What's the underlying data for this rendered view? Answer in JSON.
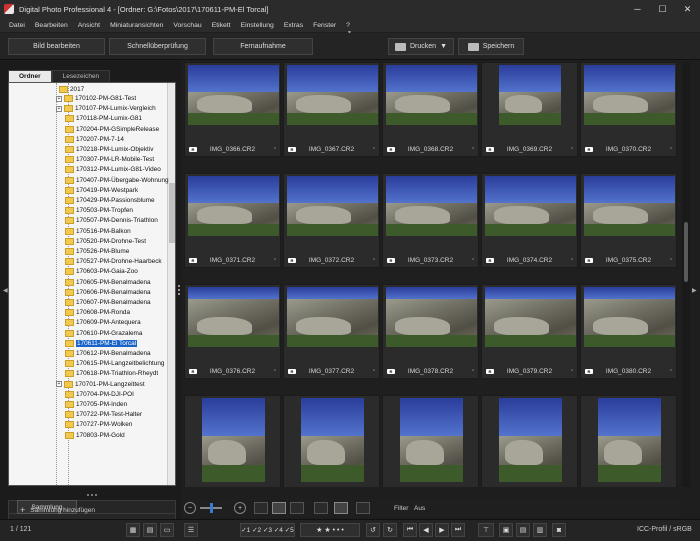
{
  "window": {
    "title": "Digital Photo Professional 4 - [Ordner: G:\\Fotos\\2017\\170611-PM-El Torcal]",
    "controls": [
      "─",
      "☐",
      "✕"
    ]
  },
  "menu": [
    "Datei",
    "Bearbeiten",
    "Ansicht",
    "Miniaturansichten",
    "Vorschau",
    "Etikett",
    "Einstellung",
    "Extras",
    "Fenster",
    "?"
  ],
  "toolbar": {
    "edit_image": "Bild bearbeiten",
    "quick_check": "Schnellüberprüfung",
    "remote_shooting": "Fernaufnahme",
    "print": "Drucken",
    "save": "Speichern"
  },
  "left_panel": {
    "tabs": [
      "Ordner",
      "Lesezeichen"
    ],
    "tree_root": "2017",
    "folders": [
      "170102-PM-G81-Test",
      "170107-PM-Lumix-Vergleich",
      "170118-PM-Lumix-G81",
      "170204-PM-GSimpleRelease",
      "170207-PM-7-14",
      "170218-PM-Lumix-Objektiv",
      "170307-PM-LR-Mobile-Test",
      "170312-PM-Lumix-G81-Video",
      "170407-PM-Übergabe-Wohnung",
      "170419-PM-Westpark",
      "170429-PM-Passionsblume",
      "170503-PM-Tropfen",
      "170507-PM-Dennis-Triathlon",
      "170516-PM-Balkon",
      "170520-PM-Drohne-Test",
      "170526-PM-Blume",
      "170527-PM-Drohne-Haarbeck",
      "170603-PM-Gaia-Zoo",
      "170605-PM-Benalmadena",
      "170606-PM-Benalmadena",
      "170607-PM-Benalmadena",
      "170608-PM-Ronda",
      "170609-PM-Antequera",
      "170610-PM-Grazalema",
      "170611-PM-El Torcal",
      "170612-PM-Benalmadena",
      "170615-PM-Langzeitbelichtung",
      "170618-PM-Triathlon-Rheydt",
      "170701-PM-Langzeittest",
      "170704-PM-DJI-POI",
      "170705-PM-Inden",
      "170722-PM-Test-Halter",
      "170727-PM-Wolken",
      "170803-PM-Gold"
    ],
    "expandable": [
      0,
      1,
      28
    ],
    "selected_index": 24,
    "collection_tab": "Sammlung",
    "add_collection": "Sammlung hinzufügen"
  },
  "grid": {
    "images": [
      "IMG_0366.CR2",
      "IMG_0367.CR2",
      "IMG_0368.CR2",
      "IMG_0369.CR2",
      "IMG_0370.CR2",
      "IMG_0371.CR2",
      "IMG_0372.CR2",
      "IMG_0373.CR2",
      "IMG_0374.CR2",
      "IMG_0375.CR2",
      "IMG_0376.CR2",
      "IMG_0377.CR2",
      "IMG_0378.CR2",
      "IMG_0379.CR2",
      "IMG_0380.CR2"
    ],
    "badge": "R"
  },
  "viewbar": {
    "minus": "−",
    "plus": "+",
    "filter_label": "Filter",
    "filter_value": "Aus"
  },
  "statusbar": {
    "count": "1 / 121",
    "color_profile": "ICC-Profil / sRGB"
  }
}
